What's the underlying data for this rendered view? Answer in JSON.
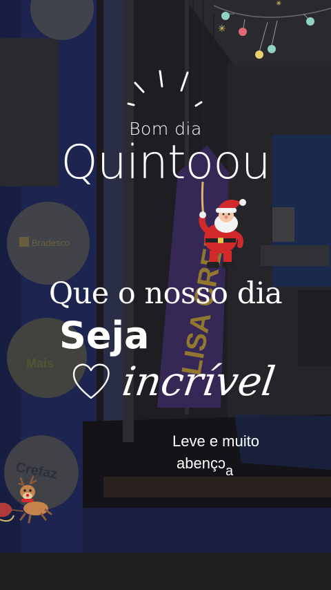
{
  "card": {
    "greeting": "Bom dia",
    "title": "Quintoou",
    "phrase": "Que o nosso dia",
    "seja": "Seja",
    "adjective": "incrível",
    "footer_line1": "Leve e muito",
    "footer_line2_start": "abençɔ",
    "footer_line2_tail": "a"
  },
  "background_signs": {
    "bank_logo": "Bradesco",
    "sign_2": "Mais",
    "sign_3": "Crefaz",
    "banner": "LISA CRED"
  },
  "decorations": {
    "icons": [
      "sun-rays-icon",
      "heart-icon",
      "santa-claus-icon",
      "reindeer-icon",
      "christmas-lights-icon"
    ],
    "colors": {
      "text": "#ffffff",
      "wall_blue": "#2c3a8f",
      "banner_purple": "#5a3b8c",
      "santa_red": "#d22a2a"
    }
  }
}
